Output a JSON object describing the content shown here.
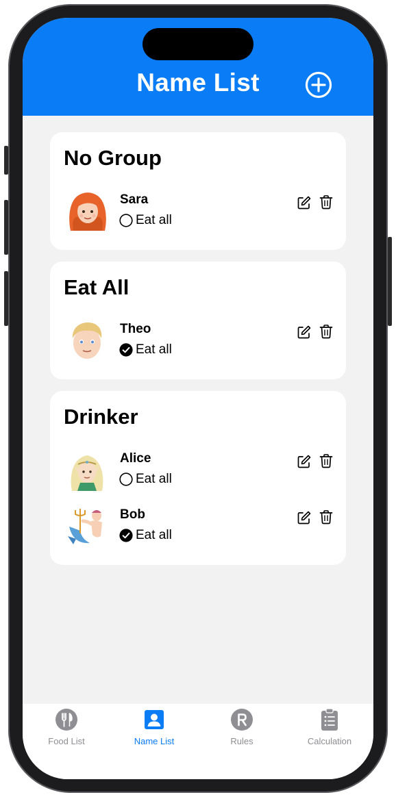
{
  "header": {
    "title": "Name List",
    "add_icon": "plus-circle-icon",
    "background": "#0a7cf5"
  },
  "groups": [
    {
      "title": "No Group",
      "members": [
        {
          "name": "Sara",
          "avatar": "red-haired-woman-emoji",
          "eat_all_label": "Eat all",
          "eat_all": false
        }
      ]
    },
    {
      "title": "Eat All",
      "members": [
        {
          "name": "Theo",
          "avatar": "blond-man-emoji",
          "eat_all_label": "Eat all",
          "eat_all": true
        }
      ]
    },
    {
      "title": "Drinker",
      "members": [
        {
          "name": "Alice",
          "avatar": "elf-woman-emoji",
          "eat_all_label": "Eat all",
          "eat_all": false
        },
        {
          "name": "Bob",
          "avatar": "merman-emoji",
          "eat_all_label": "Eat all",
          "eat_all": true
        }
      ]
    }
  ],
  "actions": {
    "edit_icon": "edit-icon",
    "delete_icon": "trash-icon"
  },
  "tabs": [
    {
      "label": "Food List",
      "icon": "fork-knife-icon",
      "active": false
    },
    {
      "label": "Name List",
      "icon": "person-icon",
      "active": true
    },
    {
      "label": "Rules",
      "icon": "r-circle-icon",
      "active": false
    },
    {
      "label": "Calculation",
      "icon": "clipboard-list-icon",
      "active": false
    }
  ],
  "colors": {
    "accent": "#0a7cf5",
    "inactive": "#8e8e93",
    "background": "#f2f2f2"
  }
}
